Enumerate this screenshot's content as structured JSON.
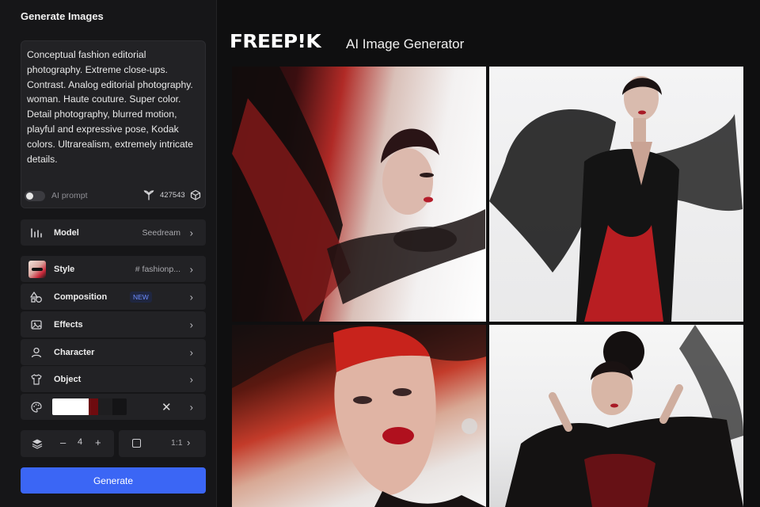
{
  "sidebar": {
    "title": "Generate Images",
    "prompt": "Conceptual fashion editorial photography. Extreme close-ups. Contrast. Analog editorial photography. woman. Haute couture. Super color. Detail photography, blurred motion, playful and expressive pose, Kodak colors. Ultrarealism, extremely intricate details.",
    "ai_prompt_label": "AI prompt",
    "seed": "427543",
    "model": {
      "label": "Model",
      "value": "Seedream"
    },
    "style": {
      "label": "Style",
      "value": "# fashionp..."
    },
    "composition": {
      "label": "Composition",
      "badge": "NEW"
    },
    "effects": {
      "label": "Effects"
    },
    "character": {
      "label": "Character"
    },
    "object": {
      "label": "Object"
    },
    "palette": {
      "colors": [
        "#ffffff",
        "#6e0b0f",
        "#1e1e20",
        "#141416"
      ]
    },
    "image_count": "4",
    "minus": "–",
    "plus": "+",
    "aspect_ratio": "1:1",
    "generate_label": "Generate"
  },
  "header": {
    "logo": "FREEP!K",
    "subtitle": "AI Image Generator"
  },
  "colors": {
    "accent": "#3b66f5",
    "background": "#0f0f10",
    "panel": "#222225"
  }
}
